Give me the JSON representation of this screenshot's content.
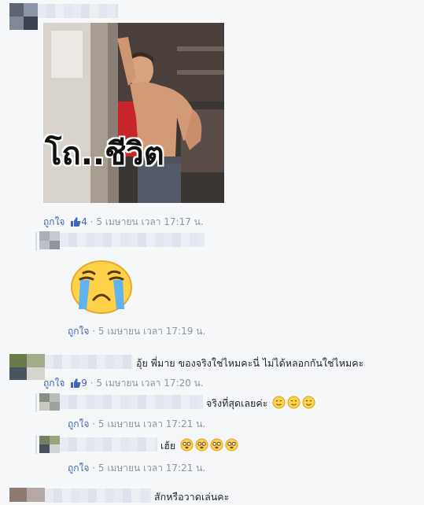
{
  "post_image": {
    "caption": "โถ..ชีวิต"
  },
  "comments": [
    {
      "meta": {
        "like": "ถูกใจ",
        "count": "4",
        "time": " · 5 เมษายน เวลา 17:17 น."
      }
    },
    {
      "meta": {
        "like": "ถูกใจ",
        "time": " · 5 เมษายน เวลา 17:19 น."
      }
    },
    {
      "text": "อุ้ย พี่มาย ของจริงใช่ไหมคะนี่ ไม่ได้หลอกกันใช่ไหมคะ",
      "meta": {
        "like": "ถูกใจ",
        "count": "9",
        "time": " · 5 เมษายน เวลา 17:20 น."
      }
    },
    {
      "text": "จริงที่สุดเลยค่ะ",
      "meta": {
        "like": "ถูกใจ",
        "time": " · 5 เมษายน เวลา 17:21 น."
      }
    },
    {
      "text": "เฮ้ย",
      "meta": {
        "like": "ถูกใจ",
        "time": " · 5 เมษายน เวลา 17:21 น."
      }
    },
    {
      "text": "สักหรือวาดเล่นคะ"
    }
  ],
  "colors": {
    "link": "#4267b2",
    "meta": "#90949c",
    "bg": "#f6f7f9"
  },
  "icons": [
    "thumbs-up-icon",
    "crying-face-sticker",
    "smiling-face-emoji",
    "flushed-face-emoji"
  ]
}
